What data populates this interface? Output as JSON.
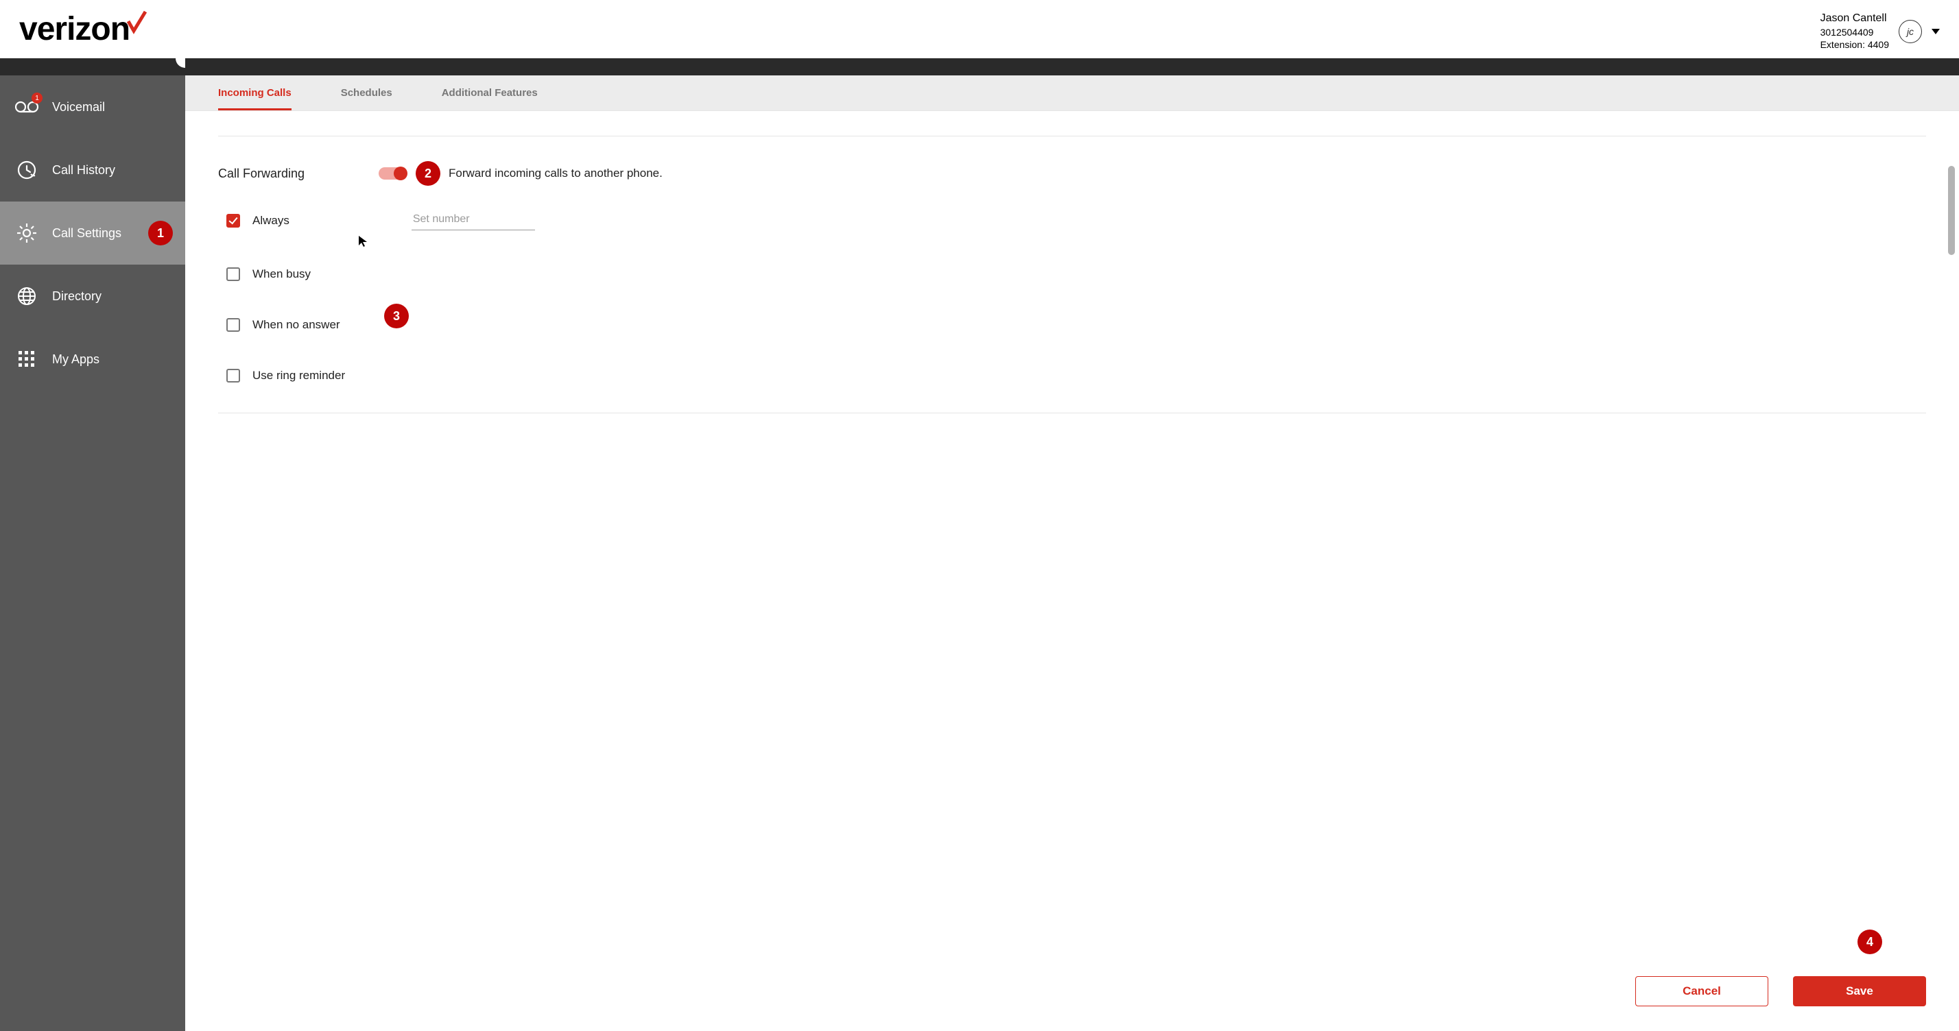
{
  "brand": {
    "name": "verizon"
  },
  "user": {
    "name": "Jason Cantell",
    "phone": "3012504409",
    "extension_label": "Extension: 4409",
    "initials": "jc"
  },
  "sidebar": {
    "items": [
      {
        "label": "Voicemail",
        "badge": "1"
      },
      {
        "label": "Call History"
      },
      {
        "label": "Call Settings"
      },
      {
        "label": "Directory"
      },
      {
        "label": "My Apps"
      }
    ]
  },
  "tabs": [
    {
      "label": "Incoming Calls"
    },
    {
      "label": "Schedules"
    },
    {
      "label": "Additional Features"
    }
  ],
  "call_forwarding": {
    "title": "Call Forwarding",
    "description": "Forward incoming calls to another phone.",
    "number_placeholder": "Set number",
    "options": {
      "always": "Always",
      "busy": "When busy",
      "no_answer": "When no answer",
      "ring_reminder": "Use ring reminder"
    }
  },
  "actions": {
    "cancel": "Cancel",
    "save": "Save"
  },
  "annotations": {
    "step1": "1",
    "step2": "2",
    "step3": "3",
    "step4": "4"
  }
}
